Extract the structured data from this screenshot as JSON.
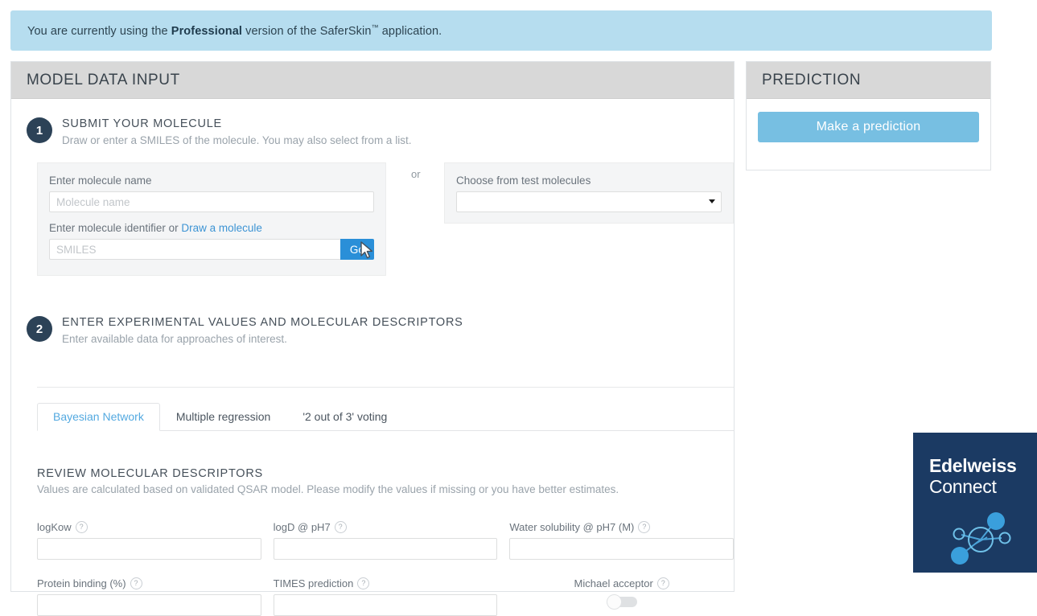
{
  "banner": {
    "prefix": "You are currently using the ",
    "emphasis": "Professional",
    "middle": " version of the SaferSkin",
    "trademark": "™",
    "suffix": " application."
  },
  "main_card": {
    "title": "MODEL DATA INPUT",
    "step1": {
      "number": "1",
      "title": "SUBMIT YOUR MOLECULE",
      "subtitle": "Draw or enter a SMILES of the molecule. You may also select from a list.",
      "molecule_name_label": "Enter molecule name",
      "molecule_name_placeholder": "Molecule name",
      "molecule_name_value": "",
      "identifier_label": "Enter molecule identifier or ",
      "draw_link": "Draw a molecule",
      "smiles_placeholder": "SMILES",
      "smiles_value": "",
      "go_label": "Go",
      "or_label": "or",
      "test_molecules_label": "Choose from test molecules",
      "test_molecules_value": "",
      "test_molecules_options": [
        ""
      ]
    },
    "step2": {
      "number": "2",
      "title": "ENTER EXPERIMENTAL VALUES AND MOLECULAR DESCRIPTORS",
      "subtitle": "Enter available data for approaches of interest.",
      "tabs": [
        {
          "label": "Bayesian Network",
          "active": true
        },
        {
          "label": "Multiple regression",
          "active": false
        },
        {
          "label": "'2 out of 3' voting",
          "active": false
        }
      ],
      "descriptors": {
        "title": "REVIEW MOLECULAR DESCRIPTORS",
        "subtitle": "Values are calculated based on validated QSAR model. Please modify the values if missing or you have better estimates.",
        "help_glyph": "?",
        "row1": [
          {
            "label": "logKow",
            "value": ""
          },
          {
            "label": "logD @ pH7",
            "value": ""
          },
          {
            "label": "Water solubility @ pH7 (M)",
            "value": ""
          }
        ],
        "row2": [
          {
            "label": "Protein binding (%)",
            "value": ""
          },
          {
            "label": "TIMES prediction",
            "value": ""
          }
        ],
        "toggle": {
          "label": "Michael acceptor",
          "state": "off"
        }
      }
    }
  },
  "prediction_card": {
    "title": "PREDICTION",
    "button_label": "Make a prediction"
  },
  "logo": {
    "line1": "Edelweiss",
    "line2": "Connect",
    "icon": "molecule-icon"
  },
  "colors": {
    "banner_bg": "#b6ddef",
    "card_header_bg": "#d8d8d8",
    "accent_blue": "#2a8fd8",
    "predict_button": "#77bfe2",
    "step_badge": "#2c4257",
    "tab_active_text": "#53a9e0",
    "logo_bg": "#1b3a63"
  }
}
